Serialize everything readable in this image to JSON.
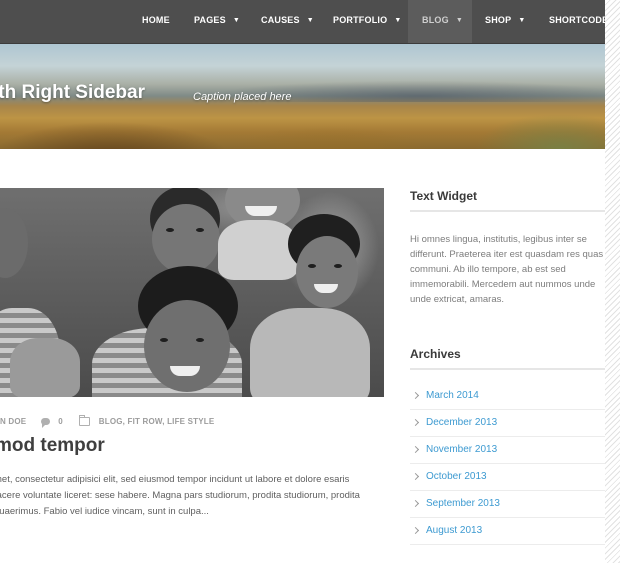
{
  "nav": {
    "items": [
      {
        "label": "HOME",
        "caret": false
      },
      {
        "label": "PAGES",
        "caret": true
      },
      {
        "label": "CAUSES",
        "caret": true
      },
      {
        "label": "PORTFOLIO",
        "caret": true
      },
      {
        "label": "BLOG",
        "caret": true
      },
      {
        "label": "SHOP",
        "caret": true
      },
      {
        "label": "SHORTCODES",
        "caret": false
      }
    ],
    "active": "BLOG",
    "caret_glyph": "▼"
  },
  "hero": {
    "title": "ith Right Sidebar",
    "caption": "Caption placed here"
  },
  "post": {
    "meta": {
      "author": "N DOE",
      "comments": "0",
      "categories": "BLOG, FIT ROW, LIFE STYLE"
    },
    "title": "mod tempor",
    "excerpt": "met, consectetur adipisici elit, sed eiusmod tempor incidunt ut labore et dolore esaris facere voluntate liceret: sese habere. Magna pars studiorum, prodita studiorum, prodita quaerimus. Fabio vel iudice vincam, sunt in culpa..."
  },
  "sidebar": {
    "text_widget": {
      "title": "Text Widget",
      "body": "Hi omnes lingua, institutis, legibus inter se differunt. Praeterea iter est quasdam res quas communi. Ab illo tempore, ab est sed immemorabili. Mercedem aut nummos unde unde extricat, amaras."
    },
    "archives": {
      "title": "Archives",
      "items": [
        "March 2014",
        "December 2013",
        "November 2013",
        "October 2013",
        "September 2013",
        "August 2013"
      ]
    }
  },
  "colors": {
    "nav_bg": "#4e4e4e",
    "link": "#3d9ad1",
    "heading": "#3a3a3a"
  }
}
